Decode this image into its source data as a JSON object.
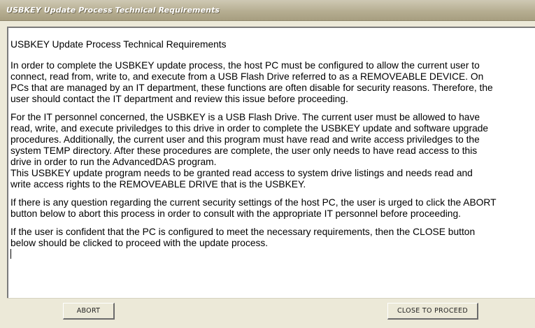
{
  "window": {
    "title": "USBKEY Update Process Technical Requirements"
  },
  "content": {
    "heading": "USBKEY Update Process Technical Requirements",
    "paragraphs": [
      [
        "In order to complete the USBKEY update process, the host PC must be configured to allow the current user to",
        "connect, read from, write to, and execute from a USB Flash Drive referred to as a REMOVEABLE DEVICE. On",
        "PCs that are managed by an IT department, these functions are often disable for security reasons. Therefore, the",
        "user should contact the IT department and review this issue before proceeding."
      ],
      [
        "For the IT personnel concerned, the USBKEY is a USB Flash Drive. The current user must be allowed to have",
        "read, write, and execute priviledges to this drive in order to complete the USBKEY update and software upgrade",
        "procedures. Additionally, the current user and this program must have read and write access priviledges to the",
        "system TEMP directory. After these procedures are complete, the user only needs to have read access to this",
        "drive in order to run the AdvancedDAS program.",
        "This USBKEY update program needs to be granted read access to system drive listings and needs read and",
        "write access rights to the REMOVEABLE DRIVE that is the USBKEY."
      ],
      [
        "If there is any question regarding the current security settings of the host PC, the user is urged to click the ABORT",
        "button below to abort this process in order to consult with the appropriate IT personnel before proceeding."
      ],
      [
        "If the user is confident that the PC is configured to meet the necessary requirements, then the CLOSE button",
        "below should be clicked to proceed with the update process."
      ]
    ]
  },
  "buttons": {
    "abort_label": "ABORT",
    "close_label": "CLOSE TO PROCEED"
  }
}
